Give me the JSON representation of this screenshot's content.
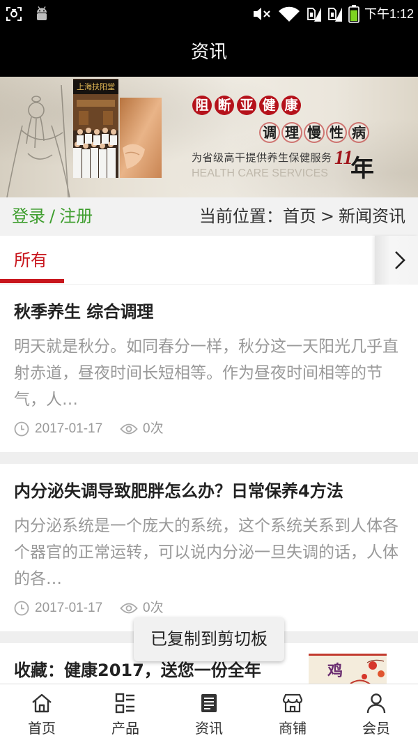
{
  "status_bar": {
    "time": "下午1:12",
    "left_icons": [
      "screenshot-icon",
      "android-icon"
    ],
    "right_icons": [
      "volume-muted-icon",
      "wifi-icon",
      "sim-1-signal-icon",
      "sim-2-signal-icon",
      "battery-icon"
    ],
    "battery_level": 0.85
  },
  "header": {
    "title": "资讯"
  },
  "banner": {
    "shop_sign": "上海扶阳堂",
    "slogan_primary": [
      "阻",
      "断",
      "亚",
      "健",
      "康"
    ],
    "slogan_secondary": [
      "调",
      "理",
      "慢",
      "性",
      "病"
    ],
    "service_line": "为省级高干提供养生保健服务",
    "years_number": "11",
    "years_unit": "年",
    "english_line": "HEALTH CARE SERVICES"
  },
  "breadcrumb": {
    "login": "登录",
    "auth_separator": "/",
    "register": "注册",
    "location_label": "当前位置：",
    "home": "首页",
    "arrow": ">",
    "current": "新闻资讯"
  },
  "tabs": {
    "items": [
      {
        "label": "所有",
        "active": true
      }
    ],
    "scroll_icon": "chevron-right-icon"
  },
  "article_meta_icons": {
    "date": "clock-icon",
    "views": "eye-icon"
  },
  "articles": [
    {
      "title": "秋季养生 综合调理",
      "summary": "明天就是秋分。如同春分一样，秋分这一天阳光几乎直射赤道，昼夜时间长短相等。作为昼夜时间相等的节气，人…",
      "date": "2017-01-17",
      "views": "0次"
    },
    {
      "title": "内分泌失调导致肥胖怎么办？日常保养4方法",
      "summary": "内分泌系统是一个庞大的系统，这个系统关系到人体各个器官的正常运转，可以说内分泌一旦失调的话，人体的各…",
      "date": "2017-01-17",
      "views": "0次"
    },
    {
      "title": "收藏：健康2017，送您一份全年",
      "thumbnail_text": "鸡"
    }
  ],
  "toast": {
    "message": "已复制到剪切板"
  },
  "bottom_nav": {
    "items": [
      {
        "label": "首页",
        "icon": "home-icon"
      },
      {
        "label": "产品",
        "icon": "product-grid-icon"
      },
      {
        "label": "资讯",
        "icon": "news-icon",
        "active": true
      },
      {
        "label": "商铺",
        "icon": "shop-icon"
      },
      {
        "label": "会员",
        "icon": "member-icon"
      }
    ]
  },
  "colors": {
    "bars_bg": "#000000",
    "accent_red": "#c8161d",
    "link_green": "#3f9e2f",
    "summary_gray": "#999999",
    "page_divider": "#efefef",
    "battery_green": "#7ed321"
  }
}
